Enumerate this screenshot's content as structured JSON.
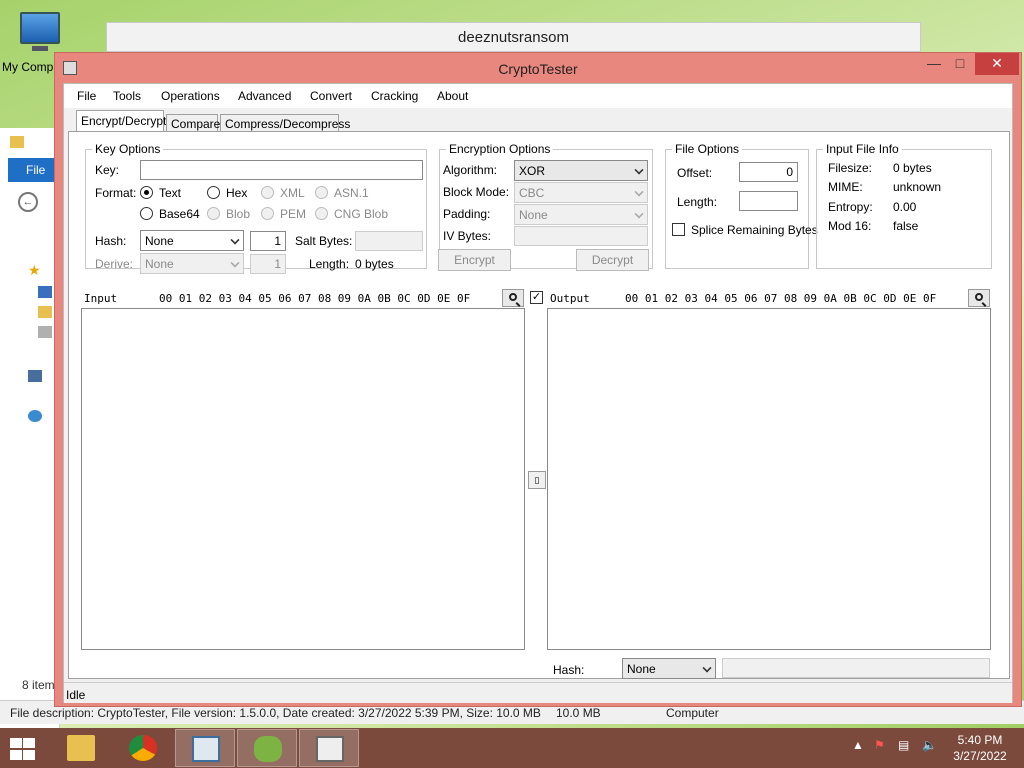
{
  "desktop": {
    "icon_label": "My Comp",
    "background_window_title": "deeznutsransom"
  },
  "explorer": {
    "file_tab": "File",
    "item_count": "8 item",
    "status_description": "File description: CryptoTester, File version: 1.5.0.0, Date created: 3/27/2022 5:39 PM, Size: 10.0 MB",
    "status_size": "10.0 MB",
    "status_location": "Computer"
  },
  "window": {
    "title": "CryptoTester"
  },
  "menu": [
    "File",
    "Tools",
    "Operations",
    "Advanced",
    "Convert",
    "Cracking",
    "About"
  ],
  "tabs": [
    "Encrypt/Decrypt",
    "Compare",
    "Compress/Decompress"
  ],
  "key_options": {
    "title": "Key Options",
    "key_label": "Key:",
    "key_value": "",
    "format_label": "Format:",
    "formats": [
      "Text",
      "Hex",
      "XML",
      "ASN.1",
      "Base64",
      "Blob",
      "PEM",
      "CNG Blob"
    ],
    "selected_format": "Text",
    "hash_label": "Hash:",
    "hash_value": "None",
    "hash_iterations": "1",
    "salt_label": "Salt Bytes:",
    "derive_label": "Derive:",
    "derive_value": "None",
    "derive_iterations": "1",
    "length_label": "Length:",
    "length_value": "0 bytes"
  },
  "encryption_options": {
    "title": "Encryption Options",
    "algorithm_label": "Algorithm:",
    "algorithm_value": "XOR",
    "block_mode_label": "Block Mode:",
    "block_mode_value": "CBC",
    "padding_label": "Padding:",
    "padding_value": "None",
    "iv_label": "IV Bytes:",
    "encrypt_button": "Encrypt",
    "decrypt_button": "Decrypt"
  },
  "file_options": {
    "title": "File Options",
    "offset_label": "Offset:",
    "offset_value": "0",
    "length_label": "Length:",
    "length_value": "",
    "splice_label": "Splice Remaining Bytes"
  },
  "input_file_info": {
    "title": "Input File Info",
    "filesize_label": "Filesize:",
    "filesize_value": "0 bytes",
    "mime_label": "MIME:",
    "mime_value": "unknown",
    "entropy_label": "Entropy:",
    "entropy_value": "0.00",
    "mod16_label": "Mod 16:",
    "mod16_value": "false"
  },
  "hex_panes": {
    "input_label": "Input",
    "output_label": "Output",
    "columns": "00 01 02 03 04 05 06 07 08 09 0A 0B 0C 0D 0E 0F",
    "sync_checked": true,
    "output_hash_label": "Hash:",
    "output_hash_value": "None"
  },
  "status": "Idle",
  "taskbar": {
    "time": "5:40 PM",
    "date": "3/27/2022"
  }
}
